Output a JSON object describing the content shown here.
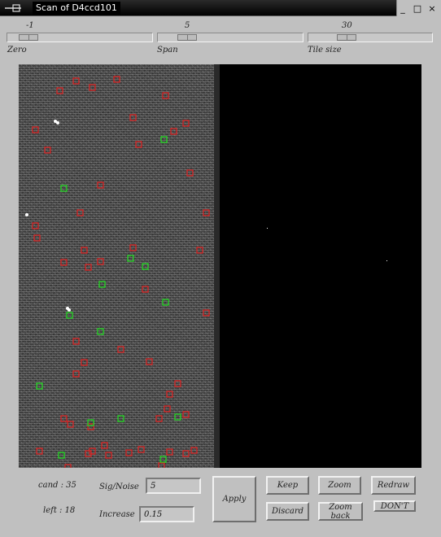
{
  "window": {
    "title": "Scan of D4ccd101",
    "menu_icon": "window-menu-icon",
    "buttons": {
      "minimize": "_",
      "maximize": "□",
      "close": "×"
    }
  },
  "sliders": [
    {
      "name": "Zero",
      "value": "-1",
      "position": 0.1
    },
    {
      "name": "Span",
      "value": "5",
      "position": 0.2
    },
    {
      "name": "Tile size",
      "value": "30",
      "position": 0.3
    }
  ],
  "markers": {
    "red_color": "#e02020",
    "green_color": "#20e020"
  },
  "stats": {
    "cand": "cand : 35",
    "left": "left : 18"
  },
  "controls": {
    "sig_noise_label": "Sig/Noise",
    "sig_noise_value": "5",
    "increase_label": "Increase",
    "increase_value": "0.15"
  },
  "buttons": {
    "apply": "Apply",
    "keep": "Keep",
    "discard": "Discard",
    "zoom": "Zoom",
    "zoom_back": "Zoom back",
    "redraw": "Redraw",
    "dont": "DON'T"
  }
}
